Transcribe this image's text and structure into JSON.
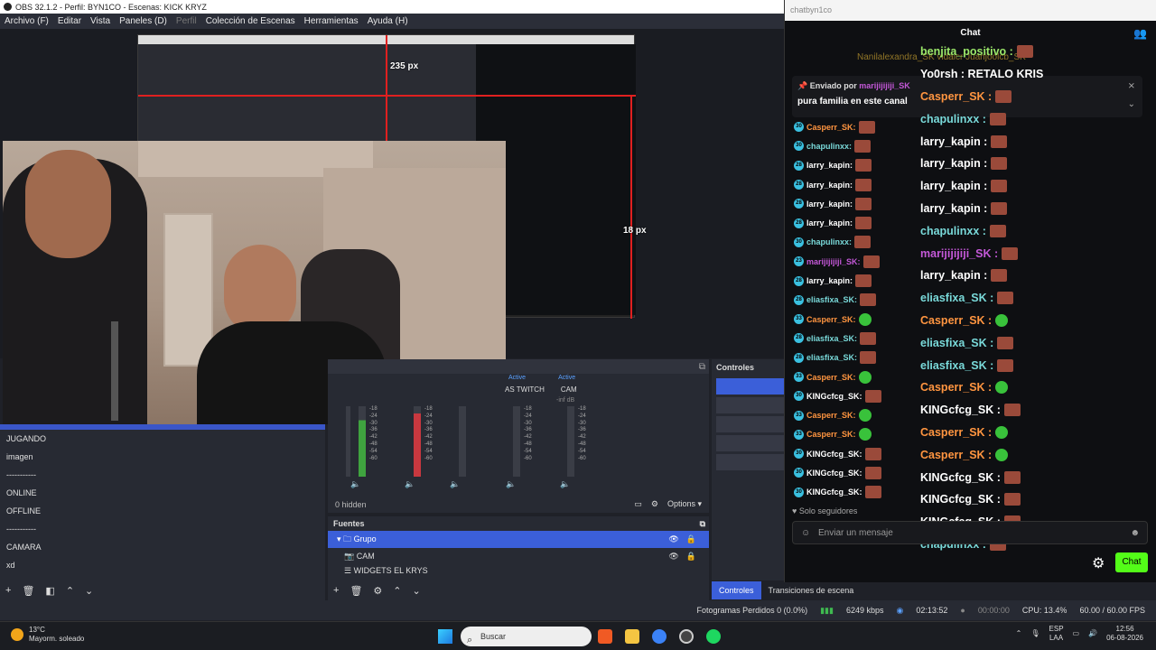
{
  "window": {
    "title": "OBS 32.1.2 - Perfil: BYN1CO - Escenas: KICK KRYZ"
  },
  "menu": [
    "Archivo (F)",
    "Editar",
    "Vista",
    "Paneles (D)",
    "Perfil",
    "Colección de Escenas",
    "Herramientas",
    "Ayuda (H)"
  ],
  "preview": {
    "label_top": "235 px",
    "label_right": "18 px"
  },
  "mixer": {
    "active_1": "Active",
    "active_2": "Active",
    "source_1": "AS TWITCH",
    "source_2": "CAM",
    "inf": "-inf dB",
    "scale": [
      "-18",
      "-24",
      "-30",
      "-36",
      "-42",
      "-48",
      "-54",
      "-60"
    ],
    "hidden": "0 hidden",
    "options": "Options"
  },
  "scenes": [
    "JUGANDO",
    "imagen",
    "-----------",
    "ONLINE",
    "OFFLINE",
    "-----------",
    "CAMARA",
    "xd"
  ],
  "sources": {
    "title": "Fuentes",
    "items": [
      "Grupo",
      "CAM",
      "WIDGETS EL KRYS"
    ]
  },
  "controls": {
    "title": "Controles"
  },
  "dock_tabs": [
    "Controles",
    "Transiciones de escena"
  ],
  "status": {
    "dropped": "Fotogramas Perdidos 0 (0.0%)",
    "bitrate": "6249 kbps",
    "live_time": "02:13:52",
    "rec_time": "00:00:00",
    "cpu": "CPU: 13.4%",
    "fps": "60.00 / 60.00 FPS"
  },
  "taskbar": {
    "temp": "13°C",
    "weather": "Mayorm. soleado",
    "search": "Buscar",
    "lang1": "ESP",
    "lang2": "LAA",
    "time": "12:56",
    "date": "06-08-2026"
  },
  "chat": {
    "browser_title": "chatbyn1co",
    "title": "Chat",
    "ticker": "Nanilalexandra_SK   vidaicr   Juanjoolcb_SK",
    "pinned_by": "Enviado por",
    "pinned_user": "marijijijiji_SK",
    "pinned_text": "pura familia en este canal",
    "messages": [
      {
        "user": "Casperr_SK:",
        "color": "#ff9540",
        "badge": "30",
        "emote": "face"
      },
      {
        "user": "chapulinxx:",
        "color": "#79d9d9",
        "badge": "30",
        "emote": "face"
      },
      {
        "user": "larry_kapin:",
        "color": "#ffffff",
        "badge": "28",
        "emote": "face"
      },
      {
        "user": "larry_kapin:",
        "color": "#ffffff",
        "badge": "28",
        "emote": "face"
      },
      {
        "user": "larry_kapin:",
        "color": "#ffffff",
        "badge": "28",
        "emote": "face"
      },
      {
        "user": "larry_kapin:",
        "color": "#ffffff",
        "badge": "28",
        "emote": "face"
      },
      {
        "user": "chapulinxx:",
        "color": "#79d9d9",
        "badge": "30",
        "emote": "face"
      },
      {
        "user": "marijijijiji_SK:",
        "color": "#c458d8",
        "badge": "23",
        "emote": "face"
      },
      {
        "user": "larry_kapin:",
        "color": "#ffffff",
        "badge": "28",
        "emote": "face"
      },
      {
        "user": "eliasfixa_SK:",
        "color": "#79d9d9",
        "badge": "28",
        "emote": "face"
      },
      {
        "user": "Casperr_SK:",
        "color": "#ff9540",
        "badge": "33",
        "emote": "check"
      },
      {
        "user": "eliasfixa_SK:",
        "color": "#79d9d9",
        "badge": "28",
        "emote": "face"
      },
      {
        "user": "eliasfixa_SK:",
        "color": "#79d9d9",
        "badge": "28",
        "emote": "face"
      },
      {
        "user": "Casperr_SK:",
        "color": "#ff9540",
        "badge": "33",
        "emote": "check"
      },
      {
        "user": "KINGcfcg_SK:",
        "color": "#ffffff",
        "badge": "30",
        "emote": "face"
      },
      {
        "user": "Casperr_SK:",
        "color": "#ff9540",
        "badge": "33",
        "emote": "check"
      },
      {
        "user": "Casperr_SK:",
        "color": "#ff9540",
        "badge": "33",
        "emote": "check"
      },
      {
        "user": "KINGcfcg_SK:",
        "color": "#ffffff",
        "badge": "30",
        "emote": "face"
      },
      {
        "user": "KINGcfcg_SK:",
        "color": "#ffffff",
        "badge": "30",
        "emote": "face"
      },
      {
        "user": "KINGcfcg_SK:",
        "color": "#ffffff",
        "badge": "30",
        "emote": "face"
      }
    ],
    "overlay": [
      {
        "user": "benjita_positivo :",
        "color": "#9be86a",
        "emote": "face"
      },
      {
        "user": "Yo0rsh : RETALO KRIS",
        "color": "#ffffff",
        "emote": ""
      },
      {
        "user": "Casperr_SK :",
        "color": "#ff9540",
        "emote": "face"
      },
      {
        "user": "chapulinxx :",
        "color": "#79d9d9",
        "emote": "face"
      },
      {
        "user": "larry_kapin :",
        "color": "#ffffff",
        "emote": "face"
      },
      {
        "user": "larry_kapin :",
        "color": "#ffffff",
        "emote": "face"
      },
      {
        "user": "larry_kapin :",
        "color": "#ffffff",
        "emote": "face"
      },
      {
        "user": "larry_kapin :",
        "color": "#ffffff",
        "emote": "face"
      },
      {
        "user": "chapulinxx :",
        "color": "#79d9d9",
        "emote": "face"
      },
      {
        "user": "marijijijiji_SK :",
        "color": "#c458d8",
        "emote": "face"
      },
      {
        "user": "larry_kapin :",
        "color": "#ffffff",
        "emote": "face"
      },
      {
        "user": "eliasfixa_SK :",
        "color": "#79d9d9",
        "emote": "face"
      },
      {
        "user": "Casperr_SK :",
        "color": "#ff9540",
        "emote": "check"
      },
      {
        "user": "eliasfixa_SK :",
        "color": "#79d9d9",
        "emote": "face"
      },
      {
        "user": "eliasfixa_SK :",
        "color": "#79d9d9",
        "emote": "face"
      },
      {
        "user": "Casperr_SK :",
        "color": "#ff9540",
        "emote": "check"
      },
      {
        "user": "KINGcfcg_SK :",
        "color": "#ffffff",
        "emote": "face"
      },
      {
        "user": "Casperr_SK :",
        "color": "#ff9540",
        "emote": "check"
      },
      {
        "user": "Casperr_SK :",
        "color": "#ff9540",
        "emote": "check"
      },
      {
        "user": "KINGcfcg_SK :",
        "color": "#ffffff",
        "emote": "face"
      },
      {
        "user": "KINGcfcg_SK :",
        "color": "#ffffff",
        "emote": "face"
      },
      {
        "user": "KINGcfcg_SK :",
        "color": "#ffffff",
        "emote": "face"
      },
      {
        "user": "chapulinxx :",
        "color": "#79d9d9",
        "emote": "face"
      }
    ],
    "followers_only": "Solo seguidores",
    "input_placeholder": "Enviar un mensaje",
    "send_button": "Chat"
  }
}
